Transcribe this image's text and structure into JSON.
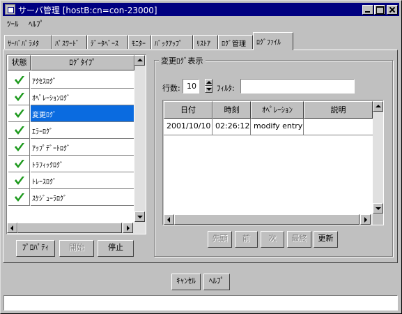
{
  "window": {
    "title": "サーバ管理 [hostB:cn=con-23000]"
  },
  "menu": {
    "items": [
      "ﾂｰﾙ",
      "ﾍﾙﾌﾟ"
    ]
  },
  "tabs": [
    "ｻｰﾊﾞﾊﾟﾗﾒﾀ",
    "ﾊﾟｽﾜｰﾄﾞ",
    "ﾃﾞｰﾀﾍﾞｰｽ",
    "ﾓﾆﾀｰ",
    "ﾊﾞｯｸｱｯﾌﾟ",
    "ﾘｽﾄｱ",
    "ﾛｸﾞ管理",
    "ﾛｸﾞﾌｧｲﾙ"
  ],
  "active_tab": "ﾛｸﾞﾌｧｲﾙ",
  "log_list": {
    "headers": {
      "status": "状態",
      "type": "ﾛｸﾞﾀｲﾌﾟ"
    },
    "rows": [
      {
        "type": "ｱｸｾｽﾛｸﾞ",
        "checked": true
      },
      {
        "type": "ｵﾍﾟﾚｰｼｮﾝﾛｸﾞ",
        "checked": true
      },
      {
        "type": "変更ﾛｸﾞ",
        "checked": true
      },
      {
        "type": "ｴﾗｰﾛｸﾞ",
        "checked": true
      },
      {
        "type": "ｱｯﾌﾟﾃﾞｰﾄﾛｸﾞ",
        "checked": true
      },
      {
        "type": "ﾄﾗﾌｨｯｸﾛｸﾞ",
        "checked": true
      },
      {
        "type": "ﾄﾚｰｽﾛｸﾞ",
        "checked": true
      },
      {
        "type": "ｽｹｼﾞｭｰﾗﾛｸﾞ",
        "checked": true
      }
    ],
    "selected": "変更ﾛｸﾞ",
    "buttons": {
      "properties": "ﾌﾟﾛﾊﾟﾃｨ",
      "start": "開始",
      "stop": "停止"
    }
  },
  "viewer": {
    "group_title": "変更ﾛｸﾞ表示",
    "rows_label": "行数:",
    "rows_value": "10",
    "filter_label": "ﾌｨﾙﾀ:",
    "filter_value": "",
    "table": {
      "columns": [
        "日付",
        "時刻",
        "ｵﾍﾟﾚｰｼｮﾝ",
        "説明"
      ],
      "rows": [
        [
          "2001/10/10",
          "02:26:12",
          "modify entry",
          ""
        ]
      ]
    },
    "nav": {
      "first": "先頭",
      "prev": "前",
      "next": "次",
      "last": "最終",
      "refresh": "更新"
    }
  },
  "footer": {
    "cancel": "ｷｬﾝｾﾙ",
    "help": "ﾍﾙﾌﾟ"
  },
  "colors": {
    "title_bar": "#000080",
    "selection": "#0a6be0",
    "check": "#1e9a1e"
  }
}
